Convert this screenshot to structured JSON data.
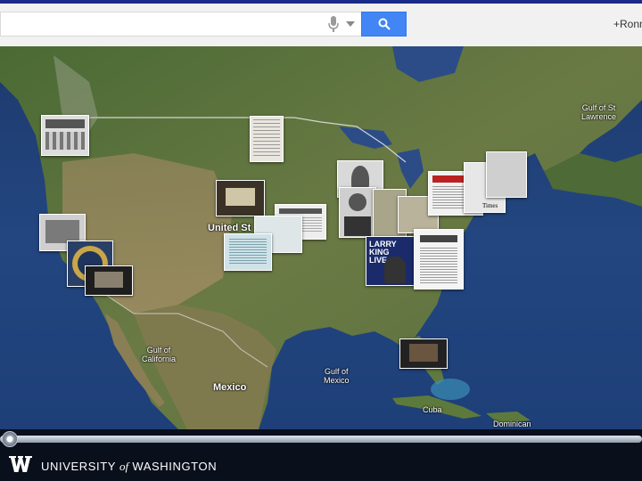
{
  "search": {
    "value": "",
    "placeholder": ""
  },
  "header": {
    "user_link": "+Ronn"
  },
  "icons": {
    "mic": "microphone-icon",
    "dropdown": "chevron-down-icon",
    "search": "search-icon",
    "uw": "uw-w-logo-icon"
  },
  "colors": {
    "search_button": "#4285f4",
    "footer_bg": "#0a0f1c",
    "ocean": "#1e3f78",
    "land": "#5b7a3e"
  },
  "map": {
    "labels": {
      "united_states": "United St",
      "gulf_st_lawrence": "Gulf of St\nLawrence",
      "gulf_california": "Gulf of\nCalifornia",
      "gulf_mexico": "Gulf of\nMexico",
      "mexico": "Mexico",
      "cuba": "Cuba",
      "dominican": "Dominican"
    },
    "photo_labels": {
      "larry_king": "LARRY\nKING\nLIVE",
      "times": "Times"
    }
  },
  "timeline": {
    "position": 0
  },
  "footer": {
    "university": "UNIVERSITY",
    "of": "of",
    "washington": "WASHINGTON"
  }
}
